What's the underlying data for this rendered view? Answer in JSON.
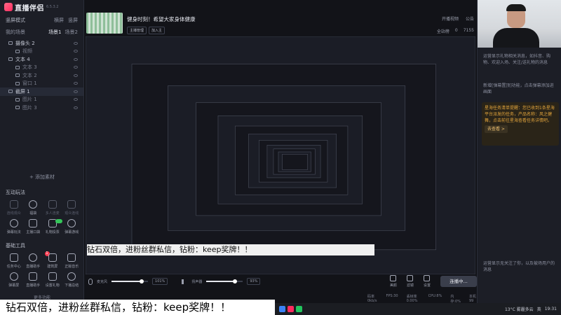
{
  "app": {
    "name": "直播伴侣",
    "version": "6.5.3.2"
  },
  "sidebar": {
    "mode": "竖屏模式",
    "mode_actions": [
      "横屏",
      "竖屏"
    ],
    "scenes_label": "我的场景",
    "scene_tabs": [
      "场景1",
      "场景2"
    ],
    "sources": [
      {
        "label": "摄像头 2",
        "sub": false,
        "selected": false
      },
      {
        "label": "视频",
        "sub": true,
        "selected": false
      },
      {
        "label": "文本 4",
        "sub": false,
        "selected": false
      },
      {
        "label": "文本 3",
        "sub": true,
        "selected": false
      },
      {
        "label": "文本 2",
        "sub": true,
        "selected": false
      },
      {
        "label": "窗口 1",
        "sub": true,
        "selected": false
      },
      {
        "label": "截屏 1",
        "sub": false,
        "selected": true
      },
      {
        "label": "图片 1",
        "sub": true,
        "selected": false
      },
      {
        "label": "图片 3",
        "sub": true,
        "selected": false
      }
    ],
    "add_source": "+ 添加素材",
    "interactive_title": "互动玩法",
    "interactive_tools": [
      {
        "label": "连线观众",
        "dim": true
      },
      {
        "label": "福袋",
        "dim": false
      },
      {
        "label": "多人连麦",
        "dim": true
      },
      {
        "label": "观众连线",
        "dim": true
      },
      {
        "label": "弹幕玩法",
        "dim": false
      },
      {
        "label": "主播口袋",
        "dim": false
      },
      {
        "label": "礼物投票",
        "dim": false,
        "toggle": true
      },
      {
        "label": "弹幕游戏",
        "dim": false
      }
    ],
    "basic_title": "基础工具",
    "basic_tools": [
      {
        "label": "任务中心",
        "badge": ""
      },
      {
        "label": "直播助手",
        "badge": "1"
      },
      {
        "label": "建筑屏",
        "badge": ""
      },
      {
        "label": "正版音乐",
        "badge": ""
      },
      {
        "label": "弹幕屏",
        "badge": ""
      },
      {
        "label": "直播助手",
        "badge": ""
      },
      {
        "label": "设置礼物",
        "badge": ""
      },
      {
        "label": "下播总结",
        "badge": ""
      }
    ],
    "more_tools": "更多功能"
  },
  "header": {
    "stream_title": "健身时刻！希望大家身体健康",
    "tags": [
      "主播管理",
      "加入主"
    ],
    "actions": [
      "开播视频",
      "公告"
    ],
    "stats": [
      "全站榜",
      "0",
      "7155"
    ]
  },
  "tickers": {
    "text": "钻石双倍，进粉丝群私信，钻粉：keep奖牌！！"
  },
  "audio": {
    "mic_label": "麦克风",
    "mic_value": "101%",
    "speaker_label": "扬声器",
    "speaker_value": "93%",
    "mic_level": 0.82,
    "speaker_level": 0.78
  },
  "controls": {
    "buttons": [
      "美颜",
      "滤镜",
      "设置"
    ],
    "live_button": "连播中..."
  },
  "status": [
    "码率0kb/s",
    "FPS:30",
    "丢帧率0.00%",
    "CPU:8%",
    "内存:0%",
    "本机 99"
  ],
  "right_panel": {
    "messages": [
      "运营显示礼物相关消息，如抖音、购物、欢迎入场、关注/送礼物的消息",
      "新增[弹幕置顶]功能，点击弹幕添加进画面",
      "运营显示无关注了你，以及被场用户的消息"
    ],
    "highlight": "星海任务清单提醒：您已收到1条星海平台派发的任务，产品名称：风之健舞，点击前往星海查看任务详情吧。",
    "highlight_link": "去查看 >"
  },
  "taskbar": {
    "weather": "13°C 雾霾多云",
    "time": "19:31",
    "lang": "英"
  }
}
